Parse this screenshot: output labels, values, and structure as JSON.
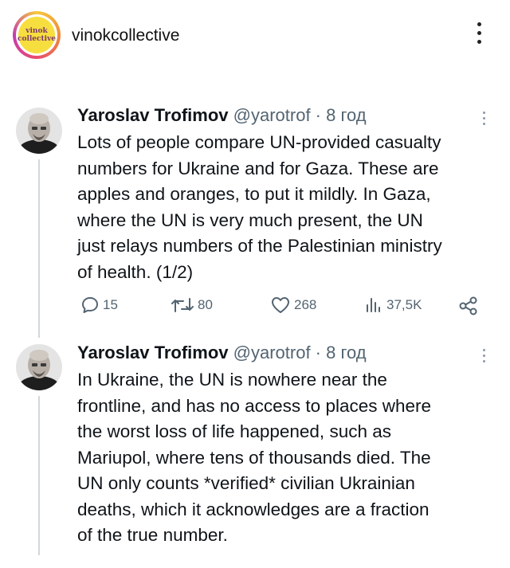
{
  "header": {
    "logo_text_line1": "vinok",
    "logo_text_line2": "collective",
    "account_name": "vinokcollective"
  },
  "tweets": [
    {
      "author_name": "Yaroslav Trofimov",
      "handle_time": "@yarotrof · 8 год",
      "lines": [
        "Lots of people compare UN-provided casualty",
        "numbers for Ukraine and for Gaza. These are",
        "apples and oranges, to put it mildly. In Gaza,",
        "where the UN is very much present, the UN",
        "just relays numbers of the Palestinian ministry",
        "of health. (1/2)"
      ],
      "replies": "15",
      "retweets": "80",
      "likes": "268",
      "views": "37,5K"
    },
    {
      "author_name": "Yaroslav Trofimov",
      "handle_time": "@yarotrof · 8 год",
      "lines": [
        "In Ukraine, the UN is nowhere near the",
        "frontline, and has no access to places where",
        "the worst loss of life happened, such as",
        "Mariupol, where tens of thousands died. The",
        "UN only counts *verified* civilian Ukrainian",
        "deaths, which it acknowledges are a fraction",
        "of the true number."
      ]
    }
  ],
  "colors": {
    "text": "#0f1419",
    "muted": "#536471",
    "thread_line": "#cfd9de",
    "logo_yellow": "#f7de3f"
  }
}
